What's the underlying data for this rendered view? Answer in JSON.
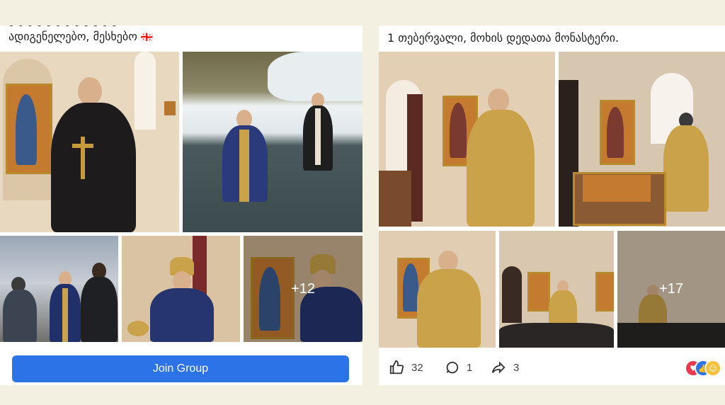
{
  "left_post": {
    "caption_line1": "ადიგენელებო, მესხებო",
    "flag": "🇬🇪",
    "more_count": "+12",
    "join_label": "Join Group"
  },
  "right_post": {
    "caption": "1 თებერვალი, მოხის დედათა მონასტერი.",
    "more_count": "+17",
    "likes": "32",
    "comments": "1",
    "shares": "3"
  },
  "colors": {
    "join_button": "#2d73e8",
    "background": "#f3efe1",
    "gold_vestment": "#c9a24a",
    "blue_vestment": "#27356f"
  }
}
